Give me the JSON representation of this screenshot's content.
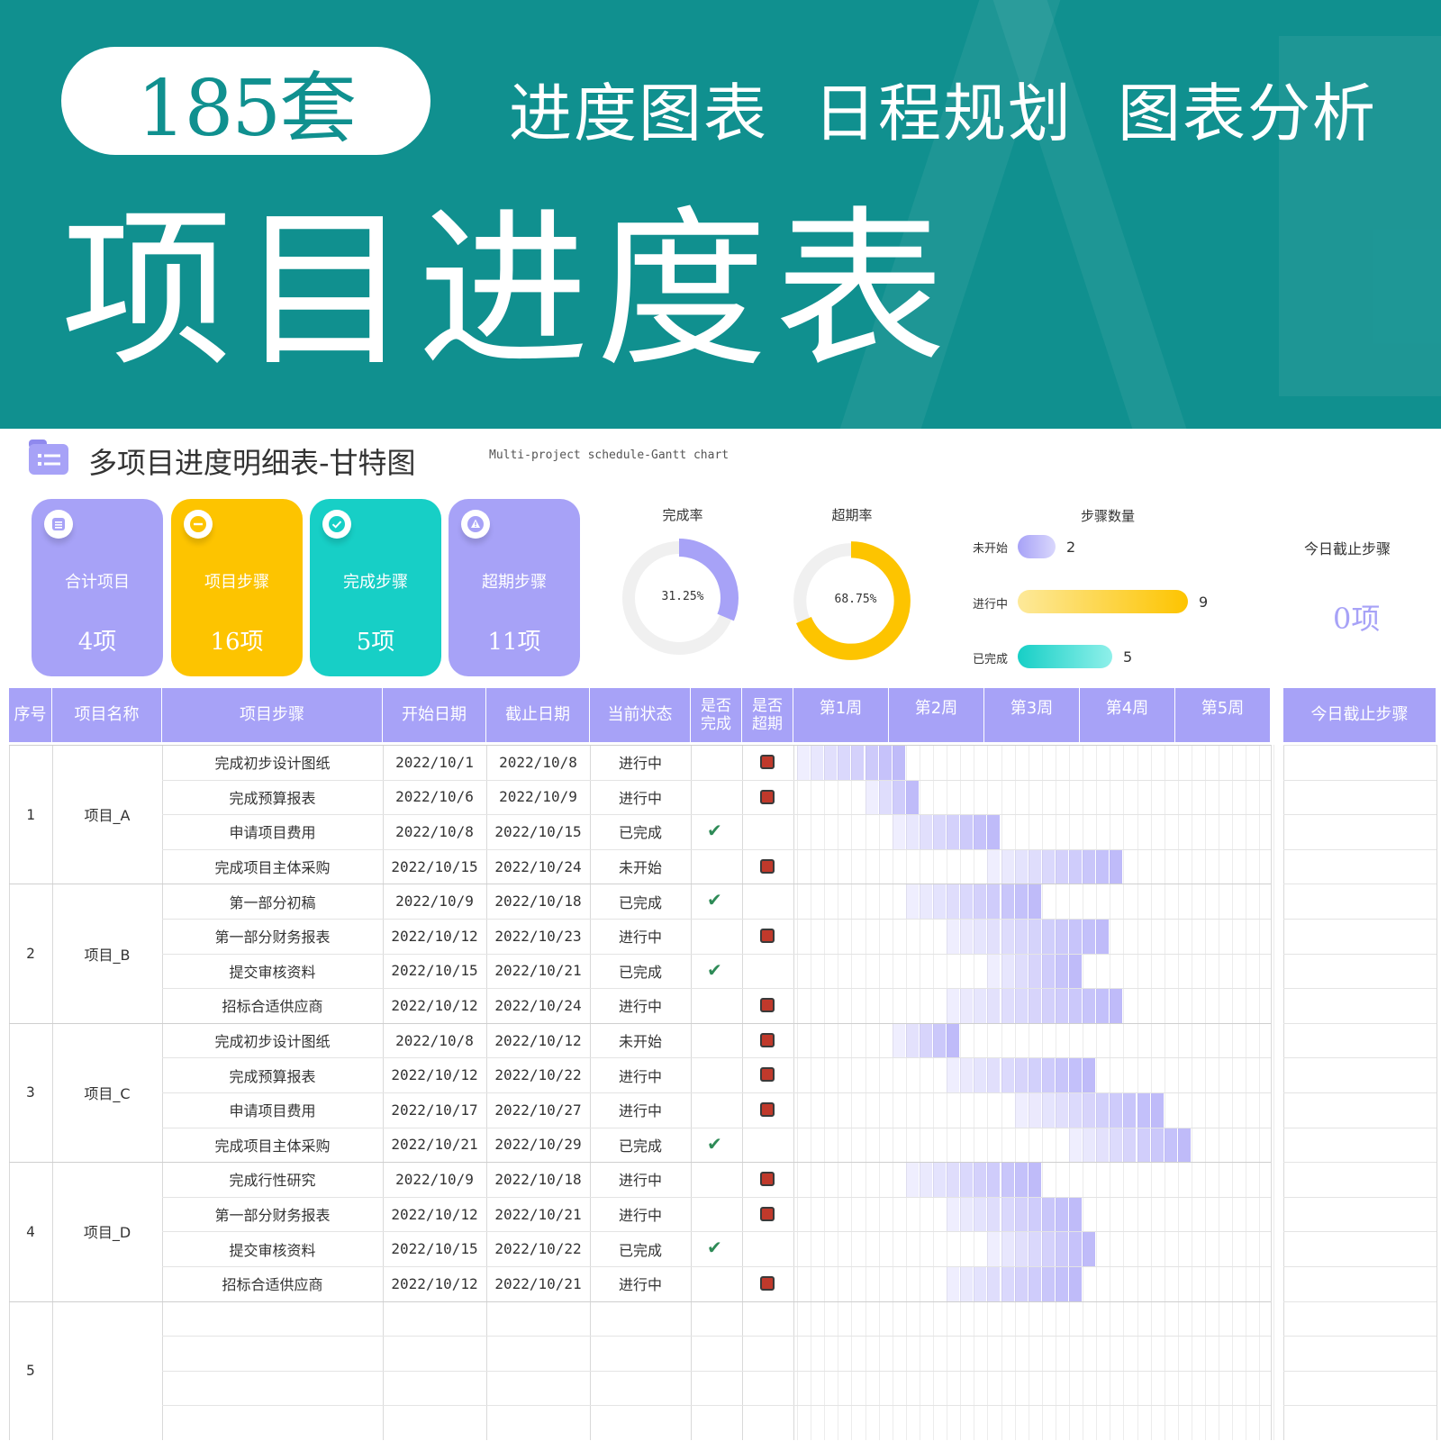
{
  "banner": {
    "badge": "185套",
    "tags": [
      "进度图表",
      "日程规划",
      "图表分析"
    ],
    "title": "项目进度表"
  },
  "sheet": {
    "title": "多项目进度明细表-甘特图",
    "subtitle": "Multi-project schedule-Gantt chart"
  },
  "kpis": [
    {
      "label": "合计项目",
      "value": "4项",
      "icon": "list-icon",
      "color": "#a7a2f7"
    },
    {
      "label": "项目步骤",
      "value": "16项",
      "icon": "minus-icon",
      "color": "#fdc400"
    },
    {
      "label": "完成步骤",
      "value": "5项",
      "icon": "check-icon",
      "color": "#17cfc6"
    },
    {
      "label": "超期步骤",
      "value": "11项",
      "icon": "warning-icon",
      "color": "#a7a2f7"
    }
  ],
  "donuts": [
    {
      "label": "完成率",
      "value_text": "31.25%",
      "fraction": 0.3125,
      "color": "#a7a2f7"
    },
    {
      "label": "超期率",
      "value_text": "68.75%",
      "fraction": 0.6875,
      "color": "#fdc400"
    }
  ],
  "steps_chart": {
    "title": "步骤数量",
    "rows": [
      {
        "label": "未开始",
        "count": "2",
        "value": 2,
        "color_from": "#a7a2f7",
        "color_to": "#d9d7fc"
      },
      {
        "label": "进行中",
        "count": "9",
        "value": 9,
        "color_from": "#fde99a",
        "color_to": "#fdc400"
      },
      {
        "label": "已完成",
        "count": "5",
        "value": 5,
        "color_from": "#17cfc6",
        "color_to": "#8ff0ea"
      }
    ]
  },
  "today": {
    "title": "今日截止步骤",
    "value": "0项"
  },
  "table": {
    "headers": {
      "seq": "序号",
      "name": "项目名称",
      "step": "项目步骤",
      "start": "开始日期",
      "end": "截止日期",
      "status": "当前状态",
      "done": "是否完成",
      "overdue": "是否超期",
      "today": "今日截止步骤"
    },
    "weeks": [
      "第1周",
      "第2周",
      "第3周",
      "第4周",
      "第5周"
    ],
    "gantt_origin": "2022/10/1",
    "projects": [
      {
        "seq": "1",
        "name": "项目_A",
        "steps": [
          {
            "step": "完成初步设计图纸",
            "start": "2022/10/1",
            "end": "2022/10/8",
            "status": "进行中",
            "done": false,
            "overdue": true
          },
          {
            "step": "完成预算报表",
            "start": "2022/10/6",
            "end": "2022/10/9",
            "status": "进行中",
            "done": false,
            "overdue": true
          },
          {
            "step": "申请项目费用",
            "start": "2022/10/8",
            "end": "2022/10/15",
            "status": "已完成",
            "done": true,
            "overdue": false
          },
          {
            "step": "完成项目主体采购",
            "start": "2022/10/15",
            "end": "2022/10/24",
            "status": "未开始",
            "done": false,
            "overdue": true
          }
        ]
      },
      {
        "seq": "2",
        "name": "项目_B",
        "steps": [
          {
            "step": "第一部分初稿",
            "start": "2022/10/9",
            "end": "2022/10/18",
            "status": "已完成",
            "done": true,
            "overdue": false
          },
          {
            "step": "第一部分财务报表",
            "start": "2022/10/12",
            "end": "2022/10/23",
            "status": "进行中",
            "done": false,
            "overdue": true
          },
          {
            "step": "提交审核资料",
            "start": "2022/10/15",
            "end": "2022/10/21",
            "status": "已完成",
            "done": true,
            "overdue": false
          },
          {
            "step": "招标合适供应商",
            "start": "2022/10/12",
            "end": "2022/10/24",
            "status": "进行中",
            "done": false,
            "overdue": true
          }
        ]
      },
      {
        "seq": "3",
        "name": "项目_C",
        "steps": [
          {
            "step": "完成初步设计图纸",
            "start": "2022/10/8",
            "end": "2022/10/12",
            "status": "未开始",
            "done": false,
            "overdue": true
          },
          {
            "step": "完成预算报表",
            "start": "2022/10/12",
            "end": "2022/10/22",
            "status": "进行中",
            "done": false,
            "overdue": true
          },
          {
            "step": "申请项目费用",
            "start": "2022/10/17",
            "end": "2022/10/27",
            "status": "进行中",
            "done": false,
            "overdue": true
          },
          {
            "step": "完成项目主体采购",
            "start": "2022/10/21",
            "end": "2022/10/29",
            "status": "已完成",
            "done": true,
            "overdue": false
          }
        ]
      },
      {
        "seq": "4",
        "name": "项目_D",
        "steps": [
          {
            "step": "完成行性研究",
            "start": "2022/10/9",
            "end": "2022/10/18",
            "status": "进行中",
            "done": false,
            "overdue": true
          },
          {
            "step": "第一部分财务报表",
            "start": "2022/10/12",
            "end": "2022/10/21",
            "status": "进行中",
            "done": false,
            "overdue": true
          },
          {
            "step": "提交审核资料",
            "start": "2022/10/15",
            "end": "2022/10/22",
            "status": "已完成",
            "done": true,
            "overdue": false
          },
          {
            "step": "招标合适供应商",
            "start": "2022/10/12",
            "end": "2022/10/21",
            "status": "进行中",
            "done": false,
            "overdue": true
          }
        ]
      },
      {
        "seq": "5",
        "name": "",
        "steps": [
          {
            "step": "",
            "start": "",
            "end": "",
            "status": "",
            "done": false,
            "overdue": false
          },
          {
            "step": "",
            "start": "",
            "end": "",
            "status": "",
            "done": false,
            "overdue": false
          },
          {
            "step": "",
            "start": "",
            "end": "",
            "status": "",
            "done": false,
            "overdue": false
          },
          {
            "step": "",
            "start": "",
            "end": "",
            "status": "",
            "done": false,
            "overdue": false
          }
        ]
      }
    ]
  }
}
